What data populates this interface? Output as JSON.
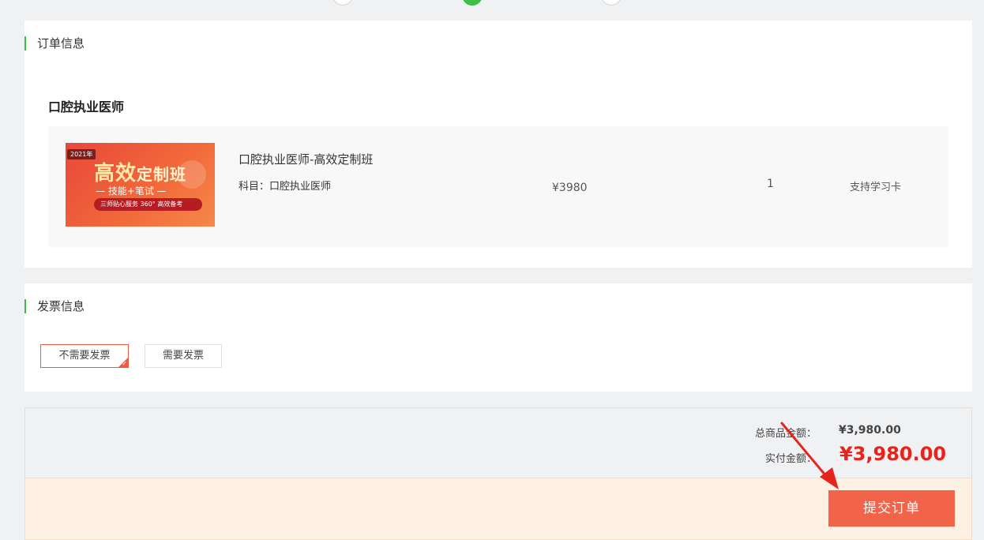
{
  "order": {
    "section_title": "订单信息",
    "course_title": "口腔执业医师",
    "item": {
      "thumbnail": {
        "year": "2021年",
        "headline_a": "高效",
        "headline_b": "定制班",
        "tagline": "— 技能+笔试 —",
        "banner": "三师贴心服务 360° 高效备考"
      },
      "name": "口腔执业医师-高效定制班",
      "subject": "科目：口腔执业医师",
      "price": "¥3980",
      "quantity": "1",
      "card_support": "支持学习卡"
    }
  },
  "invoice": {
    "section_title": "发票信息",
    "option_none": "不需要发票",
    "option_need": "需要发票",
    "selected": "不需要发票"
  },
  "summary": {
    "total_label": "总商品金额：",
    "total_value": "¥3,980.00",
    "pay_label": "实付金额：",
    "pay_value": "¥3,980.00"
  },
  "footer": {
    "submit_label": "提交订单"
  },
  "colors": {
    "accent_green": "#3fbf45",
    "accent_orange": "#f26449",
    "price_red": "#e8231b"
  }
}
